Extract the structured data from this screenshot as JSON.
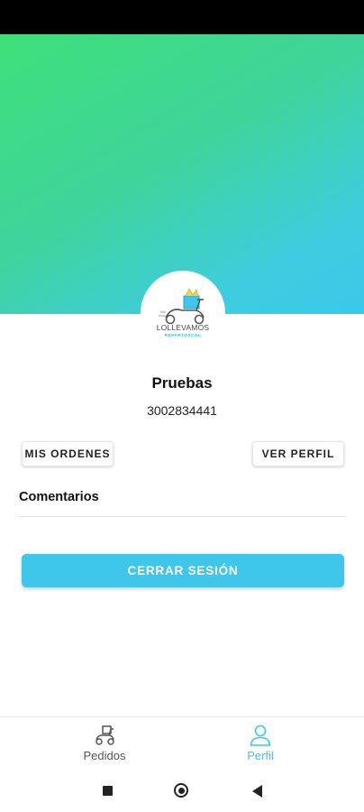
{
  "colors": {
    "gradient_start": "#3fe07a",
    "gradient_end": "#3cc8ea",
    "accent": "#3ec7ea"
  },
  "logo": {
    "brand": "LOLLEVAMOS",
    "tagline": "REPARTOSCOL"
  },
  "profile": {
    "name": "Pruebas",
    "phone": "3002834441"
  },
  "actions": {
    "orders_label": "MIS ORDENES",
    "profile_label": "VER PERFIL",
    "comments_label": "Comentarios",
    "logout_label": "CERRAR SESIÓN"
  },
  "bottom_nav": {
    "items": [
      {
        "label": "Pedidos",
        "icon": "delivery-scooter-icon",
        "active": false
      },
      {
        "label": "Perfil",
        "icon": "person-icon",
        "active": true
      }
    ]
  },
  "system_nav": {
    "icons": [
      "square-recents-icon",
      "circle-home-icon",
      "triangle-back-icon"
    ]
  }
}
